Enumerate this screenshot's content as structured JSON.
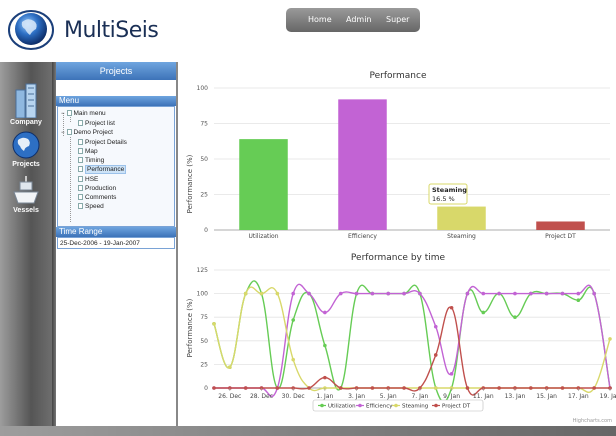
{
  "app": {
    "title": "MultiSeis"
  },
  "topnav": {
    "items": [
      "Home",
      "Admin",
      "Super"
    ]
  },
  "leftbar": {
    "items": [
      "Company",
      "Projects",
      "Vessels"
    ]
  },
  "panel": {
    "title": "Projects",
    "menu_header": "Menu",
    "tree": [
      {
        "label": "Main menu",
        "level": 0
      },
      {
        "label": "Project list",
        "level": 1
      },
      {
        "label": "Demo Project",
        "level": 0
      },
      {
        "label": "Project Details",
        "level": 1
      },
      {
        "label": "Map",
        "level": 1
      },
      {
        "label": "Timing",
        "level": 1
      },
      {
        "label": "Performance",
        "level": 1,
        "selected": true
      },
      {
        "label": "HSE",
        "level": 1
      },
      {
        "label": "Production",
        "level": 1
      },
      {
        "label": "Comments",
        "level": 1
      },
      {
        "label": "Speed",
        "level": 1
      }
    ],
    "time_range_header": "Time Range",
    "time_range_value": "25-Dec-2006 - 19-Jan-2007"
  },
  "colors": {
    "utilization": "#66cc55",
    "efficiency": "#c263d4",
    "steaming": "#d8d86a",
    "project_dt": "#c0504d",
    "accent": "#3d73b8"
  },
  "chart_data": [
    {
      "type": "bar",
      "title": "Performance",
      "ylabel": "Performance (%)",
      "categories": [
        "Utilization",
        "Efficiency",
        "Steaming",
        "Project DT"
      ],
      "values": [
        64,
        92,
        16.5,
        6
      ],
      "ylim": [
        0,
        100
      ],
      "yticks": [
        0,
        25,
        50,
        75,
        100
      ],
      "tooltip": {
        "title": "Steaming",
        "value": "16.5 %"
      },
      "grid": true
    },
    {
      "type": "line",
      "title": "Performance by time",
      "ylabel": "Performance (%)",
      "x": [
        "25. Dec",
        "26. Dec",
        "27. Dec",
        "28. Dec",
        "29. Dec",
        "30. Dec",
        "31. Dec",
        "1. Jan",
        "2. Jan",
        "3. Jan",
        "4. Jan",
        "5. Jan",
        "6. Jan",
        "7. Jan",
        "8. Jan",
        "9. Jan",
        "10. Jan",
        "11. Jan",
        "12. Jan",
        "13. Jan",
        "14. Jan",
        "15. Jan",
        "16. Jan",
        "17. Jan",
        "18. Jan",
        "19. Jan"
      ],
      "xticks": [
        "26. Dec",
        "28. Dec",
        "30. Dec",
        "1. Jan",
        "3. Jan",
        "5. Jan",
        "7. Jan",
        "9. Jan",
        "11. Jan",
        "13. Jan",
        "15. Jan",
        "17. Jan",
        "19. Jan"
      ],
      "ylim": [
        0,
        125
      ],
      "yticks": [
        0,
        25,
        50,
        75,
        100,
        125
      ],
      "series": [
        {
          "name": "Utilization",
          "values": [
            68,
            22,
            100,
            100,
            0,
            72,
            100,
            45,
            0,
            100,
            100,
            100,
            100,
            100,
            0,
            0,
            100,
            80,
            100,
            75,
            100,
            100,
            100,
            93,
            100,
            0
          ]
        },
        {
          "name": "Efficiency",
          "values": [
            0,
            0,
            0,
            0,
            0,
            100,
            100,
            80,
            100,
            100,
            100,
            100,
            100,
            100,
            65,
            15,
            100,
            100,
            100,
            100,
            100,
            100,
            100,
            100,
            100,
            0
          ]
        },
        {
          "name": "Steaming",
          "values": [
            68,
            22,
            100,
            100,
            100,
            30,
            0,
            0,
            0,
            0,
            0,
            0,
            0,
            0,
            0,
            0,
            0,
            0,
            0,
            0,
            0,
            0,
            0,
            0,
            0,
            52
          ]
        },
        {
          "name": "Project DT",
          "values": [
            0,
            0,
            0,
            0,
            0,
            0,
            0,
            11,
            0,
            0,
            0,
            0,
            0,
            0,
            35,
            85,
            0,
            0,
            0,
            0,
            0,
            0,
            0,
            0,
            0,
            0
          ]
        }
      ],
      "credits": "Highcharts.com",
      "legend": "bottom-center",
      "grid": true
    }
  ]
}
